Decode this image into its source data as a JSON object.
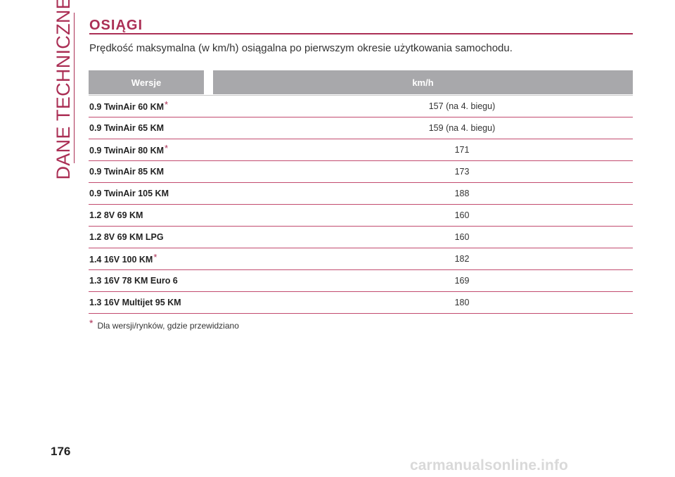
{
  "side_title": "DANE TECHNICZNE",
  "section": {
    "title": "OSIĄGI",
    "intro": "Prędkość maksymalna (w km/h) osiągalna po pierwszym okresie użytkowania samochodu."
  },
  "table": {
    "headers": {
      "versions": "Wersje",
      "speed": "km/h"
    },
    "rows": [
      {
        "version": "0.9 TwinAir 60 KM",
        "mark": "*",
        "speed": "157 (na 4. biegu)"
      },
      {
        "version": "0.9 TwinAir 65 KM",
        "mark": "",
        "speed": "159 (na 4. biegu)"
      },
      {
        "version": "0.9 TwinAir 80 KM",
        "mark": "*",
        "speed": "171"
      },
      {
        "version": "0.9 TwinAir 85 KM",
        "mark": "",
        "speed": "173"
      },
      {
        "version": "0.9 TwinAir 105 KM",
        "mark": "",
        "speed": "188"
      },
      {
        "version": "1.2 8V 69 KM",
        "mark": "",
        "speed": "160"
      },
      {
        "version": "1.2 8V 69 KM LPG",
        "mark": "",
        "speed": "160"
      },
      {
        "version": "1.4 16V 100 KM",
        "mark": "*",
        "speed": "182"
      },
      {
        "version": "1.3 16V 78 KM Euro 6",
        "mark": "",
        "speed": "169"
      },
      {
        "version": "1.3 16V Multijet 95 KM",
        "mark": "",
        "speed": "180"
      }
    ]
  },
  "footnote": {
    "mark": "*",
    "text": "Dla wersji/rynków, gdzie przewidziano"
  },
  "page_number": "176",
  "watermark": "carmanualsonline.info",
  "colors": {
    "accent": "#ab2f55",
    "header_bg": "#a8a8ab"
  }
}
